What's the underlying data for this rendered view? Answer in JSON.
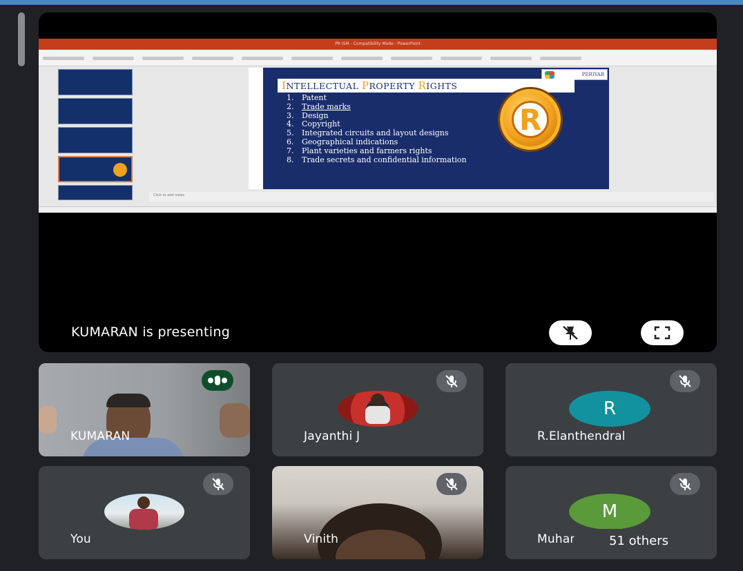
{
  "presentation": {
    "app_title": "PR ISM - Compatibility Mode - PowerPoint",
    "slide": {
      "logo_text": "PERIYAR",
      "heading_parts": [
        {
          "text": "I",
          "accent": true
        },
        {
          "text": "NTELLECTUAL ",
          "accent": false
        },
        {
          "text": "P",
          "accent": true
        },
        {
          "text": "ROPERTY ",
          "accent": false
        },
        {
          "text": "R",
          "accent": true
        },
        {
          "text": "IGHTS",
          "accent": false
        }
      ],
      "emblem": "R",
      "items": [
        {
          "num": "1.",
          "text": "Patent",
          "underline": false
        },
        {
          "num": "2.",
          "text": "Trade marks",
          "underline": true
        },
        {
          "num": "3.",
          "text": "Design",
          "underline": false
        },
        {
          "num": "4.",
          "text": "Copyright",
          "underline": false
        },
        {
          "num": "5.",
          "text": "Integrated circuits and layout designs",
          "underline": false
        },
        {
          "num": "6.",
          "text": "Geographical indications",
          "underline": false
        },
        {
          "num": "7.",
          "text": "Plant varieties and farmers rights",
          "underline": false
        },
        {
          "num": "8.",
          "text": "Trade secrets and confidential information",
          "underline": false
        }
      ]
    },
    "notes_placeholder": "Click to add notes"
  },
  "stage": {
    "presenting_text": "KUMARAN is presenting",
    "pin_button_icon": "unpin-icon",
    "fullscreen_button_icon": "fullscreen-icon"
  },
  "participants": [
    {
      "name": "KUMARAN",
      "video": true,
      "speaking": true
    },
    {
      "name": "Jayanthi J",
      "video": false,
      "avatar": "photo",
      "muted": true
    },
    {
      "name": "R.Elanthendral",
      "video": false,
      "initial": "R",
      "muted": true
    },
    {
      "name": "You",
      "video": false,
      "avatar": "photo",
      "muted": true
    },
    {
      "name": "Vinith",
      "video": true,
      "muted": true
    },
    {
      "name": "Muhammad",
      "video": false,
      "initial": "M",
      "muted": true
    }
  ],
  "others_label": "51 others",
  "colors": {
    "background": "#202124",
    "tile": "#3c4043",
    "slide_bg": "#1a2d6b",
    "accent_gold": "#e8a21a",
    "avatar_teal": "#12929e",
    "avatar_green": "#5a9a3a",
    "speaking_green": "#0f4e2a"
  }
}
